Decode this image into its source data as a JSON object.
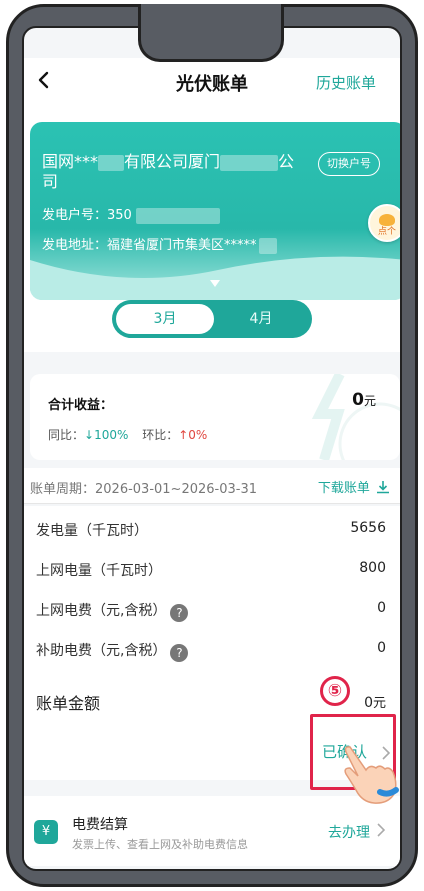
{
  "header": {
    "title": "光伏账单",
    "history_link": "历史账单"
  },
  "account": {
    "company_prefix": "国网***",
    "company_mid": "有限公司厦门",
    "company_end": "公",
    "company_wrap": "司",
    "switch_button": "切换户号",
    "generation_no_label": "发电户号：",
    "generation_no_value": "350",
    "address_label": "发电地址：",
    "address_value": "福建省厦门市集美区*****",
    "badge_text": "点个"
  },
  "months": {
    "active": "3月",
    "inactive": "4月"
  },
  "earnings": {
    "label": "合计收益：",
    "value": "0",
    "unit": "元",
    "yoy_label": "同比：",
    "yoy_value": "100%",
    "mom_label": "环比：",
    "mom_value": "0%"
  },
  "period": {
    "text": "账单周期：2026-03-01~2026-03-31",
    "download": "下载账单"
  },
  "bill": {
    "rows": [
      {
        "label": "发电量（千瓦时）",
        "value": "5656"
      },
      {
        "label": "上网电量（千瓦时）",
        "value": "800"
      },
      {
        "label": "上网电费（元,含税）",
        "value": "0"
      },
      {
        "label": "补助电费（元,含税）",
        "value": "0"
      }
    ],
    "total_label": "账单金额",
    "total_value": "0",
    "total_unit": "元",
    "confirm": "已确认"
  },
  "annotation": {
    "step": "⑤"
  },
  "service": {
    "icon": "¥",
    "title": "电费结算",
    "desc": "发票上传、查看上网及补助电费信息",
    "action": "去办理"
  },
  "colors": {
    "accent": "#1fa79a",
    "highlight": "#e0244a",
    "up": "#e0463f"
  }
}
